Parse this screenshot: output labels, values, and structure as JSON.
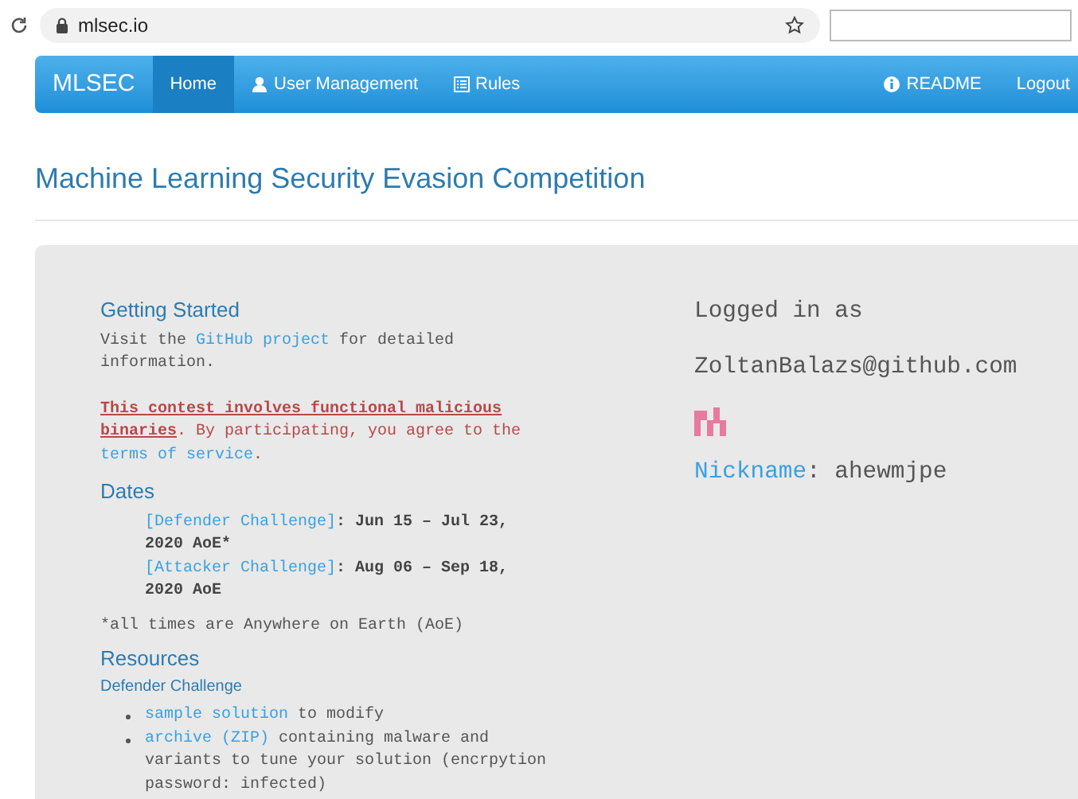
{
  "browser": {
    "url": "mlsec.io"
  },
  "navbar": {
    "brand": "MLSEC",
    "items": [
      {
        "label": "Home",
        "kind": "plain",
        "selected": true
      },
      {
        "label": "User Management",
        "kind": "user",
        "selected": false
      },
      {
        "label": "Rules",
        "kind": "list",
        "selected": false
      }
    ],
    "right_items": [
      {
        "label": "README",
        "kind": "info"
      },
      {
        "label": "Logout",
        "kind": "plain"
      }
    ]
  },
  "page_title": "Machine Learning Security Evasion Competition",
  "getting_started": {
    "heading": "Getting Started",
    "paragraphs": [
      {
        "kind": "plain",
        "parts": [
          {
            "kind": "text",
            "text": "Visit the "
          },
          {
            "kind": "link",
            "text": "GitHub project"
          },
          {
            "kind": "text",
            "text": " for detailed information."
          }
        ]
      },
      {
        "kind": "warning",
        "parts": [
          {
            "kind": "strong",
            "text": "This contest involves functional malicious binaries"
          },
          {
            "kind": "text",
            "text": ". By participating, you agree to the "
          },
          {
            "kind": "link",
            "text": "terms of service"
          },
          {
            "kind": "text",
            "text": "."
          }
        ]
      }
    ]
  },
  "dates": {
    "heading": "Dates",
    "items": [
      {
        "label": "[Defender Challenge]",
        "text": ": Jun 15 – Jul 23, 2020 AoE*"
      },
      {
        "label": "[Attacker Challenge]",
        "text": ": Aug 06 – Sep 18, 2020 AoE"
      }
    ],
    "note": "*all times are Anywhere on Earth (AoE)"
  },
  "resources": {
    "heading": "Resources",
    "subheading": "Defender Challenge",
    "items": [
      {
        "parts": [
          {
            "kind": "link",
            "text": "sample solution"
          },
          {
            "kind": "text",
            "text": " to modify"
          }
        ]
      },
      {
        "parts": [
          {
            "kind": "link",
            "text": "archive (ZIP)"
          },
          {
            "kind": "text",
            "text": " containing malware and variants to tune your solution (encrpytion password: infected)"
          }
        ]
      }
    ]
  },
  "account": {
    "logged_in_label": "Logged in as",
    "email": "ZoltanBalazs@github.com",
    "nickname_label": "Nickname",
    "nickname": ": ahewmjpe"
  }
}
